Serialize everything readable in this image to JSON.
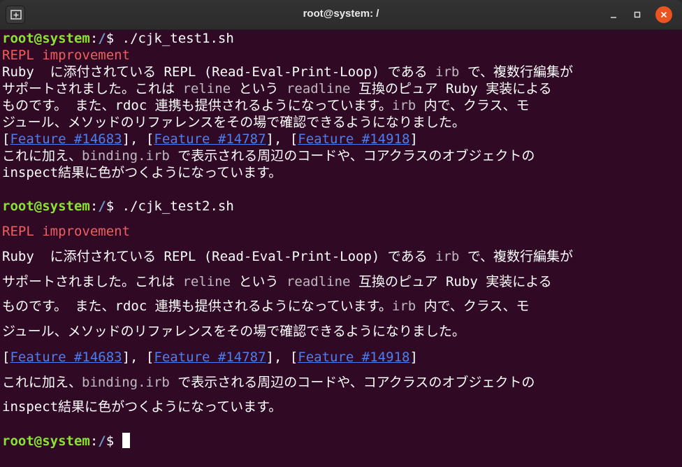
{
  "window": {
    "title": "root@system: /"
  },
  "prompt": {
    "user": "root@system",
    "colon": ":",
    "path": "/",
    "symbol": "$ "
  },
  "commands": {
    "cmd1": "./cjk_test1.sh",
    "cmd2": "./cjk_test2.sh"
  },
  "output": {
    "heading": "REPL improvement",
    "line1": {
      "a": "Ruby  に添付されている REPL (Read-Eval-Print-Loop) である ",
      "irb": "irb",
      "b": " で、複数行編集が"
    },
    "line2": {
      "a": "サポートされました。これは ",
      "reline": "reline",
      "b": " という ",
      "readline": "readline",
      "c": " 互換のピュア Ruby 実装による"
    },
    "line3": {
      "a": "ものです。 また、rdoc 連携も提供されるようになっています。",
      "irb": "irb",
      "b": " 内で、クラス、モ"
    },
    "line4": "ジュール、メソッドのリファレンスをその場で確認できるようになりました。",
    "line5": {
      "open1": "[",
      "link1": "Feature #14683",
      "sep1": "], [",
      "link2": "Feature #14787",
      "sep2": "], [",
      "link3": "Feature #14918",
      "close": "]"
    },
    "line6": {
      "a": "これに加え、",
      "binding": "binding.irb",
      "b": " で表示される周辺のコードや、コアクラスのオブジェクトの"
    },
    "line7": "inspect結果に色がつくようになっています。"
  },
  "colors": {
    "background": "#300a24",
    "prompt_user": "#8ae234",
    "prompt_path": "#729fcf",
    "heading": "#ef5f5f",
    "link": "#4d7ef0",
    "close_button": "#e95420"
  }
}
